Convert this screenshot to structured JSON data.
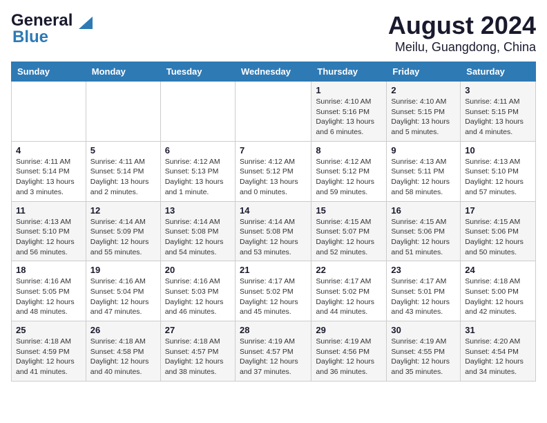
{
  "header": {
    "logo_line1": "General",
    "logo_line2": "Blue",
    "title": "August 2024",
    "subtitle": "Meilu, Guangdong, China"
  },
  "days_of_week": [
    "Sunday",
    "Monday",
    "Tuesday",
    "Wednesday",
    "Thursday",
    "Friday",
    "Saturday"
  ],
  "weeks": [
    [
      {
        "day": "",
        "info": ""
      },
      {
        "day": "",
        "info": ""
      },
      {
        "day": "",
        "info": ""
      },
      {
        "day": "",
        "info": ""
      },
      {
        "day": "1",
        "info": "Sunrise: 4:10 AM\nSunset: 5:16 PM\nDaylight: 13 hours\nand 6 minutes."
      },
      {
        "day": "2",
        "info": "Sunrise: 4:10 AM\nSunset: 5:15 PM\nDaylight: 13 hours\nand 5 minutes."
      },
      {
        "day": "3",
        "info": "Sunrise: 4:11 AM\nSunset: 5:15 PM\nDaylight: 13 hours\nand 4 minutes."
      }
    ],
    [
      {
        "day": "4",
        "info": "Sunrise: 4:11 AM\nSunset: 5:14 PM\nDaylight: 13 hours\nand 3 minutes."
      },
      {
        "day": "5",
        "info": "Sunrise: 4:11 AM\nSunset: 5:14 PM\nDaylight: 13 hours\nand 2 minutes."
      },
      {
        "day": "6",
        "info": "Sunrise: 4:12 AM\nSunset: 5:13 PM\nDaylight: 13 hours\nand 1 minute."
      },
      {
        "day": "7",
        "info": "Sunrise: 4:12 AM\nSunset: 5:12 PM\nDaylight: 13 hours\nand 0 minutes."
      },
      {
        "day": "8",
        "info": "Sunrise: 4:12 AM\nSunset: 5:12 PM\nDaylight: 12 hours\nand 59 minutes."
      },
      {
        "day": "9",
        "info": "Sunrise: 4:13 AM\nSunset: 5:11 PM\nDaylight: 12 hours\nand 58 minutes."
      },
      {
        "day": "10",
        "info": "Sunrise: 4:13 AM\nSunset: 5:10 PM\nDaylight: 12 hours\nand 57 minutes."
      }
    ],
    [
      {
        "day": "11",
        "info": "Sunrise: 4:13 AM\nSunset: 5:10 PM\nDaylight: 12 hours\nand 56 minutes."
      },
      {
        "day": "12",
        "info": "Sunrise: 4:14 AM\nSunset: 5:09 PM\nDaylight: 12 hours\nand 55 minutes."
      },
      {
        "day": "13",
        "info": "Sunrise: 4:14 AM\nSunset: 5:08 PM\nDaylight: 12 hours\nand 54 minutes."
      },
      {
        "day": "14",
        "info": "Sunrise: 4:14 AM\nSunset: 5:08 PM\nDaylight: 12 hours\nand 53 minutes."
      },
      {
        "day": "15",
        "info": "Sunrise: 4:15 AM\nSunset: 5:07 PM\nDaylight: 12 hours\nand 52 minutes."
      },
      {
        "day": "16",
        "info": "Sunrise: 4:15 AM\nSunset: 5:06 PM\nDaylight: 12 hours\nand 51 minutes."
      },
      {
        "day": "17",
        "info": "Sunrise: 4:15 AM\nSunset: 5:06 PM\nDaylight: 12 hours\nand 50 minutes."
      }
    ],
    [
      {
        "day": "18",
        "info": "Sunrise: 4:16 AM\nSunset: 5:05 PM\nDaylight: 12 hours\nand 48 minutes."
      },
      {
        "day": "19",
        "info": "Sunrise: 4:16 AM\nSunset: 5:04 PM\nDaylight: 12 hours\nand 47 minutes."
      },
      {
        "day": "20",
        "info": "Sunrise: 4:16 AM\nSunset: 5:03 PM\nDaylight: 12 hours\nand 46 minutes."
      },
      {
        "day": "21",
        "info": "Sunrise: 4:17 AM\nSunset: 5:02 PM\nDaylight: 12 hours\nand 45 minutes."
      },
      {
        "day": "22",
        "info": "Sunrise: 4:17 AM\nSunset: 5:02 PM\nDaylight: 12 hours\nand 44 minutes."
      },
      {
        "day": "23",
        "info": "Sunrise: 4:17 AM\nSunset: 5:01 PM\nDaylight: 12 hours\nand 43 minutes."
      },
      {
        "day": "24",
        "info": "Sunrise: 4:18 AM\nSunset: 5:00 PM\nDaylight: 12 hours\nand 42 minutes."
      }
    ],
    [
      {
        "day": "25",
        "info": "Sunrise: 4:18 AM\nSunset: 4:59 PM\nDaylight: 12 hours\nand 41 minutes."
      },
      {
        "day": "26",
        "info": "Sunrise: 4:18 AM\nSunset: 4:58 PM\nDaylight: 12 hours\nand 40 minutes."
      },
      {
        "day": "27",
        "info": "Sunrise: 4:18 AM\nSunset: 4:57 PM\nDaylight: 12 hours\nand 38 minutes."
      },
      {
        "day": "28",
        "info": "Sunrise: 4:19 AM\nSunset: 4:57 PM\nDaylight: 12 hours\nand 37 minutes."
      },
      {
        "day": "29",
        "info": "Sunrise: 4:19 AM\nSunset: 4:56 PM\nDaylight: 12 hours\nand 36 minutes."
      },
      {
        "day": "30",
        "info": "Sunrise: 4:19 AM\nSunset: 4:55 PM\nDaylight: 12 hours\nand 35 minutes."
      },
      {
        "day": "31",
        "info": "Sunrise: 4:20 AM\nSunset: 4:54 PM\nDaylight: 12 hours\nand 34 minutes."
      }
    ]
  ]
}
